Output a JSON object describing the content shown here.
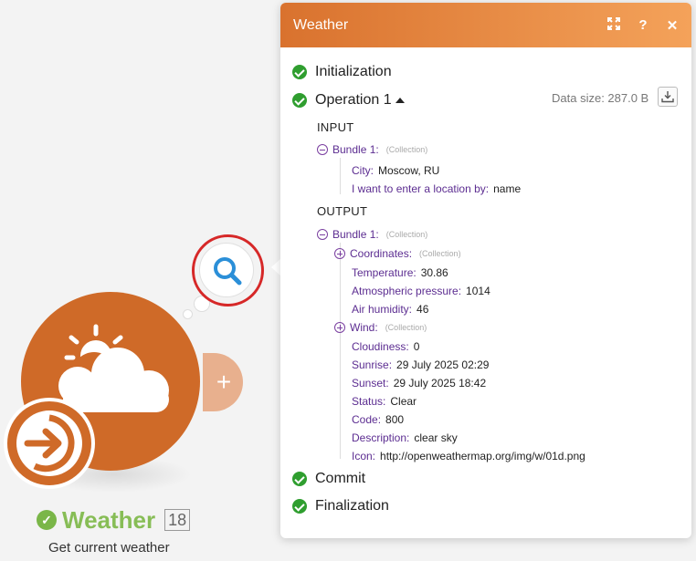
{
  "panel": {
    "title": "Weather",
    "data_size": "Data size: 287.0 B",
    "steps": {
      "initialization": "Initialization",
      "operation": "Operation 1",
      "commit": "Commit",
      "finalization": "Finalization"
    },
    "input": {
      "heading": "INPUT",
      "bundle_label": "Bundle 1:",
      "bundle_type": "(Collection)",
      "fields": [
        {
          "key": "City:",
          "value": "Moscow, RU"
        },
        {
          "key": "I want to enter a location by:",
          "value": "name"
        }
      ]
    },
    "output": {
      "heading": "OUTPUT",
      "bundle_label": "Bundle 1:",
      "bundle_type": "(Collection)",
      "coordinates": {
        "key": "Coordinates:",
        "type": "(Collection)"
      },
      "temperature": {
        "key": "Temperature:",
        "value": "30.86"
      },
      "pressure": {
        "key": "Atmospheric pressure:",
        "value": "1014"
      },
      "humidity": {
        "key": "Air humidity:",
        "value": "46"
      },
      "wind": {
        "key": "Wind:",
        "type": "(Collection)"
      },
      "cloudiness": {
        "key": "Cloudiness:",
        "value": "0"
      },
      "sunrise": {
        "key": "Sunrise:",
        "value": "29 July 2025 02:29"
      },
      "sunset": {
        "key": "Sunset:",
        "value": "29 July 2025 18:42"
      },
      "status": {
        "key": "Status:",
        "value": "Clear"
      },
      "code": {
        "key": "Code:",
        "value": "800"
      },
      "description": {
        "key": "Description:",
        "value": "clear sky"
      },
      "icon": {
        "key": "Icon:",
        "value": "http://openweathermap.org/img/w/01d.png"
      }
    }
  },
  "module": {
    "title": "Weather",
    "count": "18",
    "subtitle": "Get current weather"
  },
  "colors": {
    "module_orange": "#cf6a28",
    "header_start": "#d9722e",
    "header_end": "#f4a25a",
    "success_green": "#2f9e2f",
    "title_green": "#87bd56",
    "key_purple": "#5c2d91",
    "highlight_red": "#d62828"
  },
  "icons": {
    "expand": "expand-icon",
    "help": "help-icon",
    "close": "close-icon",
    "download": "download-icon",
    "search": "search-icon",
    "weather": "sun-cloud-icon",
    "trigger": "arrow-right-circle-icon",
    "add": "plus-icon"
  }
}
